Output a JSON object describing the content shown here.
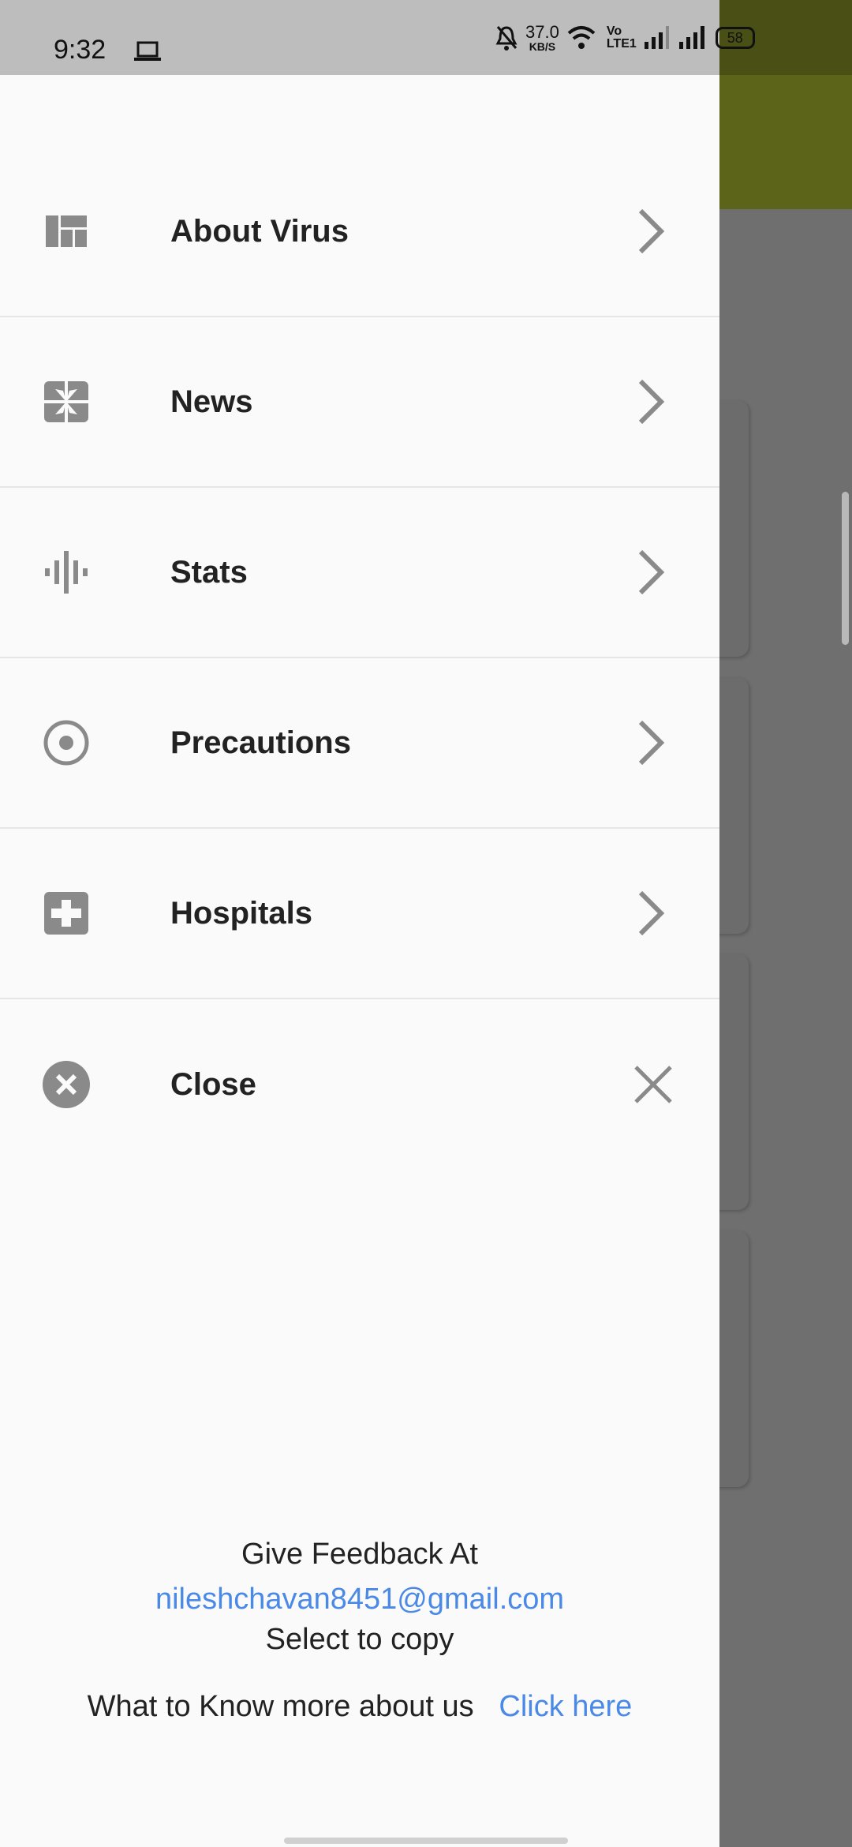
{
  "status_bar": {
    "time": "9:32",
    "net_speed": "37.0",
    "net_unit": "KB/S",
    "volte": "Vo",
    "lte": "LTE1",
    "battery": "58"
  },
  "drawer": {
    "items": [
      {
        "label": "About Virus",
        "icon": "dashboard-icon",
        "trailing": "chevron-right-icon"
      },
      {
        "label": "News",
        "icon": "news-icon",
        "trailing": "chevron-right-icon"
      },
      {
        "label": "Stats",
        "icon": "graphic-eq-icon",
        "trailing": "chevron-right-icon"
      },
      {
        "label": "Precautions",
        "icon": "radio-button-icon",
        "trailing": "chevron-right-icon"
      },
      {
        "label": "Hospitals",
        "icon": "local-hospital-icon",
        "trailing": "chevron-right-icon"
      },
      {
        "label": "Close",
        "icon": "cancel-icon",
        "trailing": "close-icon"
      }
    ],
    "footer": {
      "feedback_label": "Give Feedback At",
      "email": "nileshchavan8451@gmail.com",
      "copy_hint": "Select to copy",
      "about_text": "What to Know more about us",
      "about_link": "Click here"
    }
  },
  "colors": {
    "icon_gray": "#8a8a8a",
    "link": "#4a8ae6",
    "appbar": "#5b6419",
    "scrim": "#6f6f6f"
  }
}
